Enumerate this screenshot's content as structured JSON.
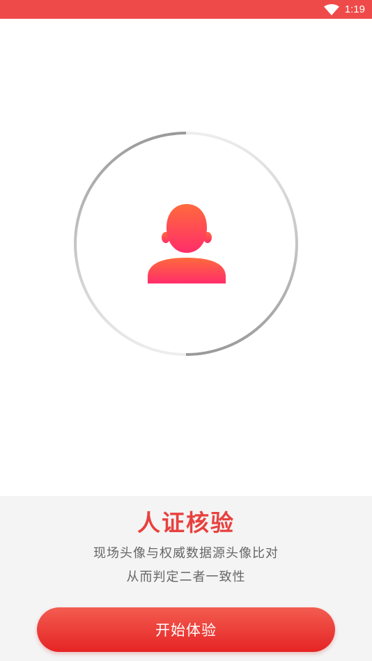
{
  "status_bar": {
    "time": "1:19",
    "wifi_icon": "wifi-icon",
    "color": "#ef4a4a"
  },
  "scanner": {
    "avatar_icon": "person-avatar-icon",
    "avatar_gradient": [
      "#ff6a3d",
      "#ff2d6a"
    ]
  },
  "info": {
    "title": "人证核验",
    "description_line1": "现场头像与权威数据源头像比对",
    "description_line2": "从而判定二者一致性"
  },
  "actions": {
    "start_label": "开始体验"
  },
  "colors": {
    "accent": "#e8413f",
    "button_top": "#f35c50",
    "button_bottom": "#e52424"
  }
}
